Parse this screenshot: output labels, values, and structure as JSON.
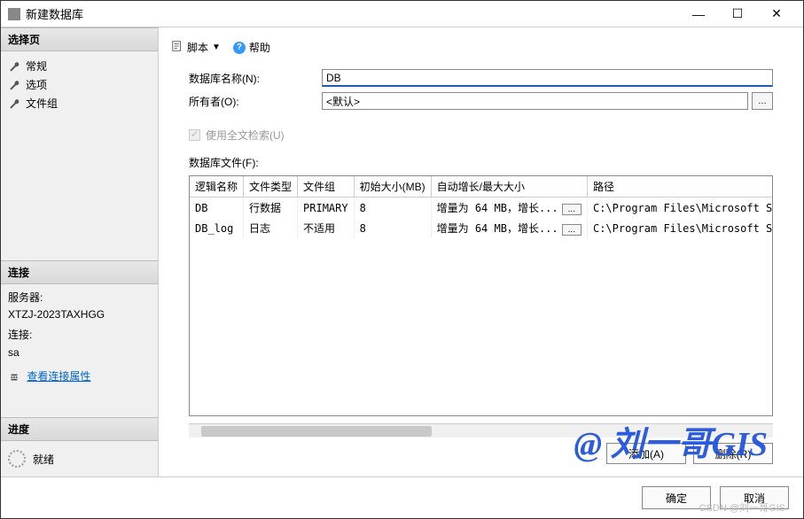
{
  "window": {
    "title": "新建数据库"
  },
  "titlebar_controls": {
    "minimize": "—",
    "maximize": "☐",
    "close": "✕"
  },
  "sidebar": {
    "select_page_header": "选择页",
    "items": [
      {
        "label": "常规"
      },
      {
        "label": "选项"
      },
      {
        "label": "文件组"
      }
    ],
    "connection_header": "连接",
    "connection": {
      "server_label": "服务器:",
      "server_value": "XTZJ-2023TAXHGG",
      "conn_label": "连接:",
      "conn_value": "sa",
      "view_props_label": "查看连接属性"
    },
    "progress_header": "进度",
    "progress": {
      "status": "就绪"
    }
  },
  "toolbar": {
    "script_label": "脚本",
    "help_label": "帮助"
  },
  "form": {
    "db_name_label": "数据库名称(N):",
    "db_name_value": "DB",
    "owner_label": "所有者(O):",
    "owner_value": "<默认>",
    "fulltext_label": "使用全文检索(U)",
    "files_label": "数据库文件(F):"
  },
  "table": {
    "headers": {
      "name": "逻辑名称",
      "type": "文件类型",
      "group": "文件组",
      "size": "初始大小(MB)",
      "growth": "自动增长/最大大小",
      "path": "路径"
    },
    "rows": [
      {
        "name": "DB",
        "type": "行数据",
        "group": "PRIMARY",
        "size": "8",
        "growth": "增量为 64 MB，增长...",
        "path": "C:\\Program Files\\Microsoft SQL Ser"
      },
      {
        "name": "DB_log",
        "type": "日志",
        "group": "不适用",
        "size": "8",
        "growth": "增量为 64 MB，增长...",
        "path": "C:\\Program Files\\Microsoft SQL Ser"
      }
    ]
  },
  "actions": {
    "add": "添加(A)",
    "delete": "删除(R)"
  },
  "footer": {
    "ok": "确定",
    "cancel": "取消"
  },
  "watermark": "@ 刘一哥GIS",
  "watermark2": "CSDN @刘一哥GIS"
}
